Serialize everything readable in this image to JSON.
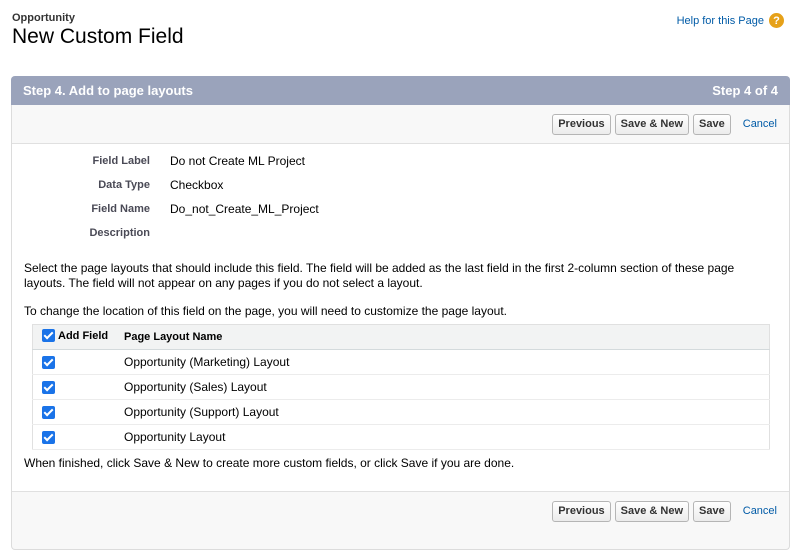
{
  "header": {
    "object_name": "Opportunity",
    "title": "New Custom Field",
    "help_link": "Help for this Page",
    "help_icon": "question-icon"
  },
  "step": {
    "title": "Step 4. Add to page layouts",
    "counter": "Step 4 of 4"
  },
  "buttons": {
    "previous": "Previous",
    "save_new": "Save & New",
    "save": "Save",
    "cancel": "Cancel"
  },
  "fields": [
    {
      "label": "Field Label",
      "value": "Do not Create ML Project"
    },
    {
      "label": "Data Type",
      "value": "Checkbox"
    },
    {
      "label": "Field Name",
      "value": "Do_not_Create_ML_Project"
    },
    {
      "label": "Description",
      "value": ""
    }
  ],
  "instructions": {
    "p1": "Select the page layouts that should include this field. The field will be added as the last field in the first 2-column section of these page layouts. The field will not appear on any pages if you do not select a layout.",
    "p2": "To change the location of this field on the page, you will need to customize the page layout."
  },
  "table": {
    "col_add_field": "Add Field",
    "col_layout_name": "Page Layout Name",
    "header_checked": true,
    "rows": [
      {
        "name": "Opportunity (Marketing) Layout",
        "checked": true
      },
      {
        "name": "Opportunity (Sales) Layout",
        "checked": true
      },
      {
        "name": "Opportunity (Support) Layout",
        "checked": true
      },
      {
        "name": "Opportunity Layout",
        "checked": true
      }
    ]
  },
  "finish_text": "When finished, click Save & New to create more custom fields, or click Save if you are done.",
  "colors": {
    "step_header": "#9aa3bb",
    "link": "#015ba7",
    "checkbox": "#1a73e8",
    "help_icon": "#e6a119"
  }
}
